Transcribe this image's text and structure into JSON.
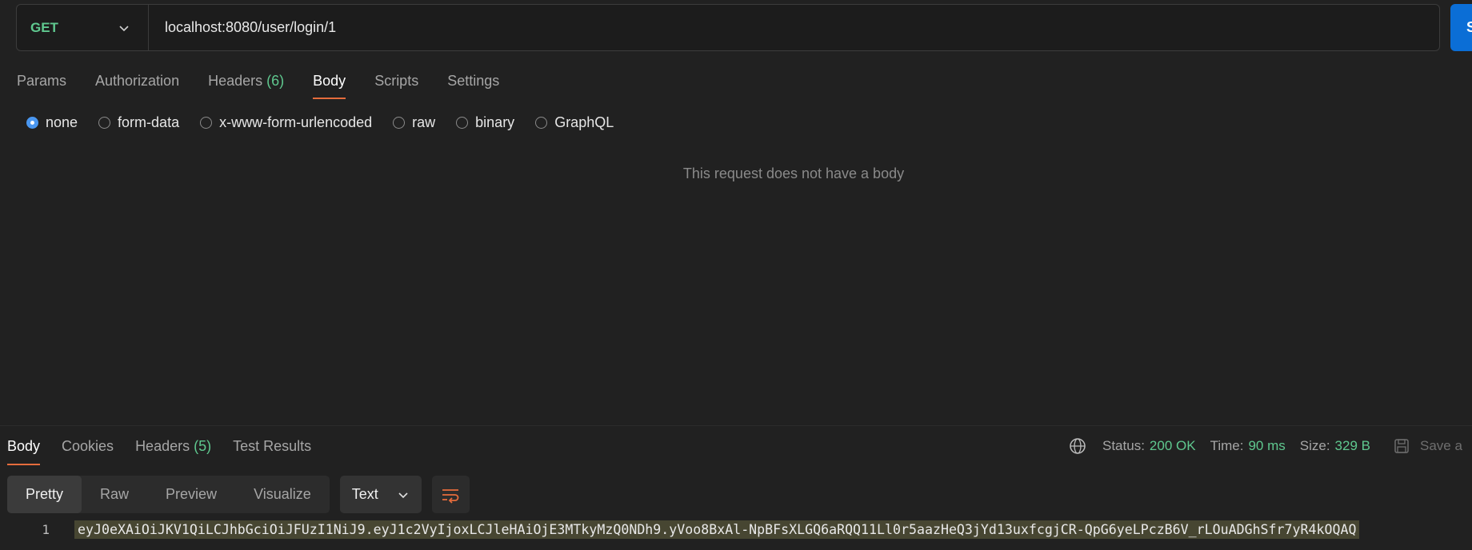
{
  "request": {
    "method": "GET",
    "url": "localhost:8080/user/login/1",
    "send_label": "S"
  },
  "request_tabs": [
    {
      "label": "Params",
      "count": ""
    },
    {
      "label": "Authorization",
      "count": ""
    },
    {
      "label": "Headers",
      "count": "(6)"
    },
    {
      "label": "Body",
      "count": "",
      "active": true
    },
    {
      "label": "Scripts",
      "count": ""
    },
    {
      "label": "Settings",
      "count": ""
    }
  ],
  "body_types": [
    {
      "label": "none",
      "checked": true
    },
    {
      "label": "form-data",
      "checked": false
    },
    {
      "label": "x-www-form-urlencoded",
      "checked": false
    },
    {
      "label": "raw",
      "checked": false
    },
    {
      "label": "binary",
      "checked": false
    },
    {
      "label": "GraphQL",
      "checked": false
    }
  ],
  "empty_body_message": "This request does not have a body",
  "response_tabs": [
    {
      "label": "Body",
      "count": "",
      "active": true
    },
    {
      "label": "Cookies",
      "count": ""
    },
    {
      "label": "Headers",
      "count": "(5)"
    },
    {
      "label": "Test Results",
      "count": ""
    }
  ],
  "status": {
    "status_label": "Status:",
    "status_value": "200 OK",
    "time_label": "Time:",
    "time_value": "90 ms",
    "size_label": "Size:",
    "size_value": "329 B",
    "save_label": "Save a"
  },
  "format": {
    "modes": [
      "Pretty",
      "Raw",
      "Preview",
      "Visualize"
    ],
    "active_mode": "Pretty",
    "language": "Text"
  },
  "response_body": {
    "line_number": "1",
    "text": "eyJ0eXAiOiJKV1QiLCJhbGciOiJFUzI1NiJ9.eyJ1c2VyIjoxLCJleHAiOjE3MTkyMzQ0NDh9.yVoo8BxAl-NpBFsXLGQ6aRQQ11Ll0r5aazHeQ3jYd13uxfcgjCR-QpG6yeLPczB6V_rLOuADGhSfr7yR4kOQAQ"
  },
  "colors": {
    "accent_orange": "#e56c3c",
    "method_green": "#5fc88f",
    "send_blue": "#0b6ed6",
    "radio_blue": "#4a97f0"
  }
}
